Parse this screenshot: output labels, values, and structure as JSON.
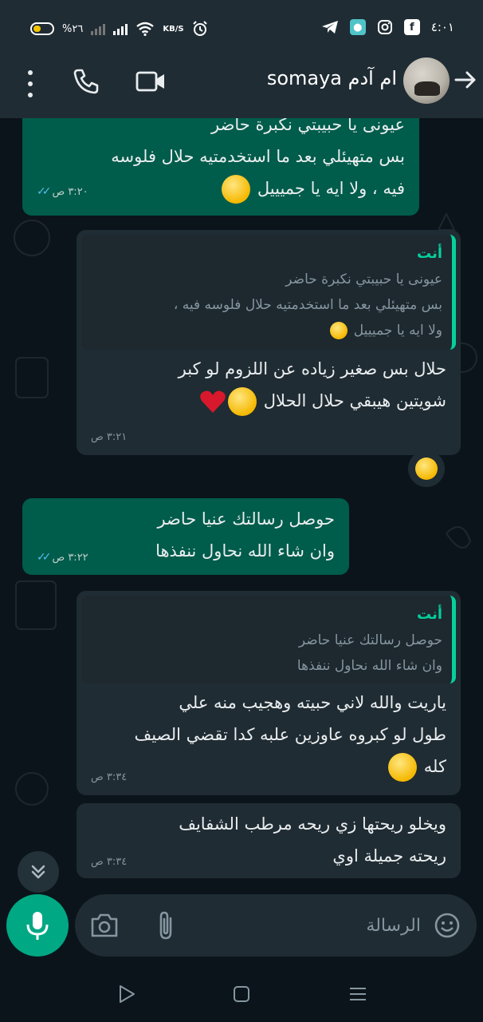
{
  "status_bar": {
    "time": "٤:٠١",
    "battery": "%٢٦",
    "net_speed": "KB/S",
    "icons": [
      "telegram-icon",
      "app-icon",
      "instagram-icon",
      "facebook-icon",
      "alarm-icon",
      "wifi-icon",
      "signal-icon"
    ]
  },
  "header": {
    "contact_name": "ام آدم somaya",
    "icons": [
      "back-arrow-icon",
      "video-call-icon",
      "voice-call-icon",
      "more-menu-icon"
    ]
  },
  "messages": [
    {
      "direction": "out",
      "lines": [
        "عيونى يا حبيبتي نكبرة حاضر",
        "بس متهيئلي بعد ما استخدمتيه حلال فلوسه",
        "فيه ، ولا ايه يا جميييل"
      ],
      "emoji": "kiss",
      "time": "٣:٢٠ ص",
      "read": true
    },
    {
      "direction": "in",
      "quote": {
        "author": "أنت",
        "lines": [
          "عيونى يا حبيبتي نكبرة حاضر",
          "بس متهيئلي بعد ما استخدمتيه حلال فلوسه فيه ،",
          "ولا ايه يا جميييل"
        ]
      },
      "lines": [
        "حلال بس صغير زياده عن اللزوم لو كبر",
        "شويتين هيبقي حلال الحلال"
      ],
      "emoji": "rolling-laughing-heart",
      "time": "٣:٢١ ص",
      "reaction": "joy"
    },
    {
      "direction": "out",
      "lines": [
        "حوصل رسالتك عنيا حاضر",
        "وان شاء الله نحاول ننفذها"
      ],
      "time": "٣:٢٢ ص",
      "read": true
    },
    {
      "direction": "in",
      "quote": {
        "author": "أنت",
        "lines": [
          "حوصل رسالتك عنيا حاضر",
          "وان شاء الله نحاول ننفذها"
        ]
      },
      "lines": [
        "ياريت والله لاني حبيته وهجيب منه علي",
        "طول لو كبروه عاوزين علبه كدا تقضي الصيف",
        "كله"
      ],
      "emoji": "rolling-laughing",
      "time": "٣:٣٤ ص"
    },
    {
      "direction": "in",
      "lines": [
        "ويخلو ريحتها زي ريحه مرطب الشفايف",
        "ريحته جميلة اوي"
      ],
      "time": "٣:٣٤ ص"
    }
  ],
  "input": {
    "placeholder": "الرسالة",
    "icons": [
      "emoji-icon",
      "attach-icon",
      "camera-icon",
      "mic-icon"
    ]
  },
  "colors": {
    "background": "#0b141a",
    "bar": "#1f2c34",
    "outgoing_bubble": "#005c4b",
    "incoming_bubble": "#202c33",
    "accent": "#00a884",
    "quote_accent": "#06cf9c",
    "read_ticks": "#53bdeb"
  }
}
